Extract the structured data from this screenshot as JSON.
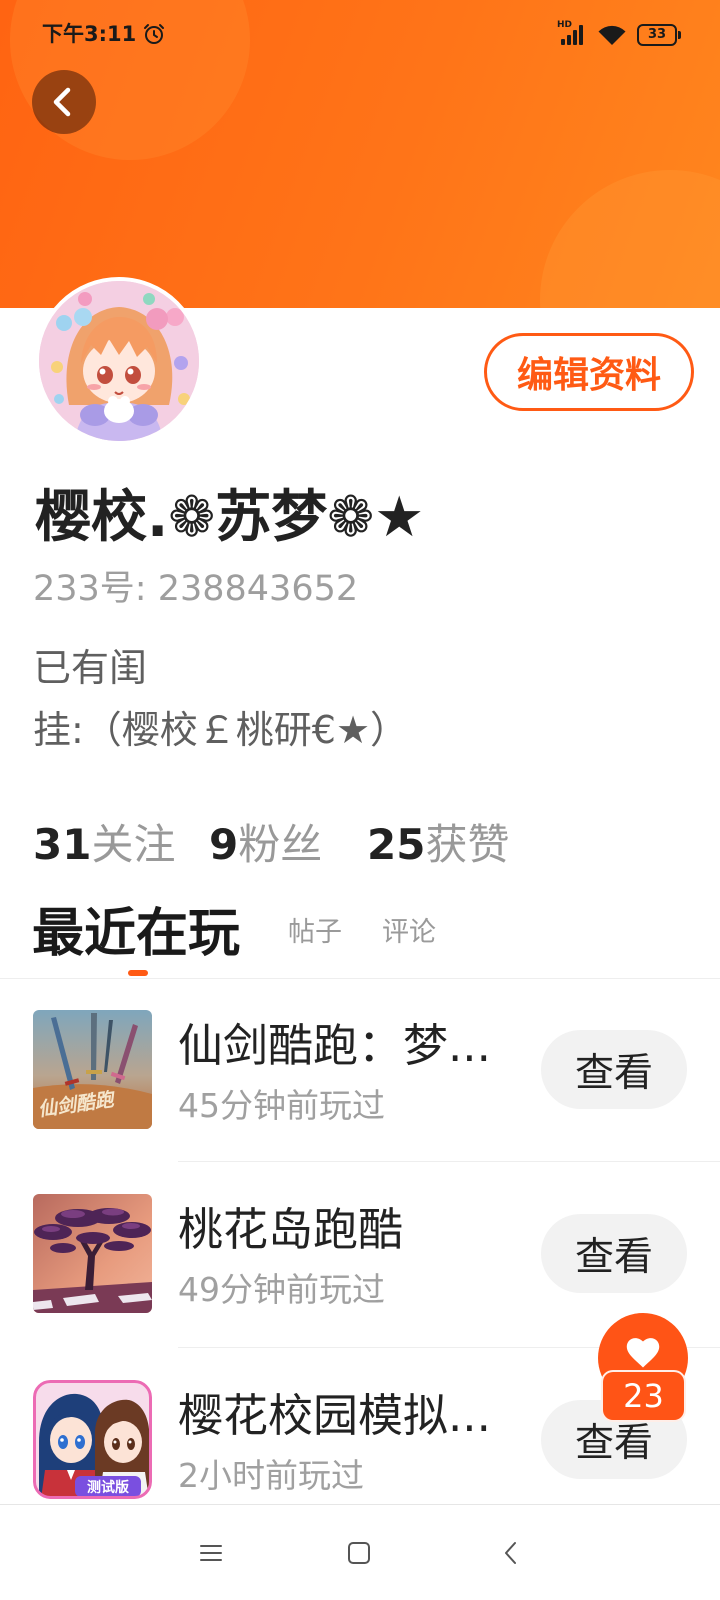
{
  "status_bar": {
    "time": "下午3:11",
    "alarm_icon": "alarm-clock-icon",
    "network_label": "HD",
    "signal_icon": "cellular-signal-icon",
    "wifi_icon": "wifi-icon",
    "battery_level": "33"
  },
  "header": {
    "back_icon": "chevron-left-icon"
  },
  "profile": {
    "edit_button_label": "编辑资料",
    "name": "樱校.❁苏梦❁★",
    "id_line": "233号: 238843652",
    "bio": [
      "已有闺",
      "挂:（樱校￡桃研€★）"
    ],
    "stats": [
      {
        "value": "31",
        "label": "关注"
      },
      {
        "value": "9",
        "label": "粉丝"
      },
      {
        "value": "25",
        "label": "获赞"
      }
    ]
  },
  "tabs": [
    {
      "label": "最近在玩",
      "active": true
    },
    {
      "label": "帖子",
      "active": false
    },
    {
      "label": "评论",
      "active": false
    }
  ],
  "recent_games": [
    {
      "title": "仙剑酷跑：梦...",
      "last_played": "45分钟前玩过",
      "action_label": "查看",
      "icon_text": "仙剑酷跑"
    },
    {
      "title": "桃花岛跑酷",
      "last_played": "49分钟前玩过",
      "action_label": "查看"
    },
    {
      "title": "樱花校园模拟...",
      "last_played": "2小时前玩过",
      "action_label": "查看",
      "icon_text": "测试版"
    }
  ],
  "like_button": {
    "icon": "heart-icon",
    "count": "23"
  },
  "system_nav": {
    "icons": [
      "menu-icon",
      "home-square-icon",
      "back-chevron-icon"
    ]
  },
  "colors": {
    "accent": "#FF5A14",
    "text_primary": "#222222",
    "text_secondary": "#999999",
    "button_bg": "#F2F2F2"
  }
}
